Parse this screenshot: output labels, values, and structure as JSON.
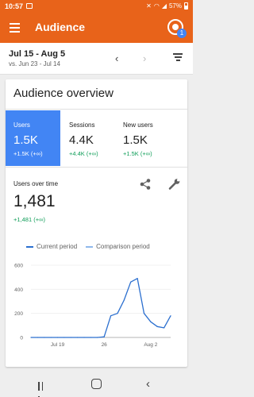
{
  "status_bar": {
    "time": "10:57",
    "battery": "57%"
  },
  "app_bar": {
    "title": "Audience",
    "badge": "1"
  },
  "date_range": {
    "current": "Jul 15 - Aug 5",
    "comparison": "vs. Jun 23 - Jul 14"
  },
  "card": {
    "title": "Audience overview",
    "metrics": [
      {
        "label": "Users",
        "value": "1.5K",
        "delta": "+1.5K (+∞)"
      },
      {
        "label": "Sessions",
        "value": "4.4K",
        "delta": "+4.4K (+∞)"
      },
      {
        "label": "New users",
        "value": "1.5K",
        "delta": "+1.5K (+∞)"
      }
    ],
    "users_over_time": {
      "label": "Users over time",
      "value": "1,481",
      "delta": "+1,481 (+∞)"
    }
  },
  "chart_data": {
    "type": "line",
    "series": [
      {
        "name": "Current period",
        "color": "#2b6fcf",
        "x": [
          "Jul 15",
          "Jul 16",
          "Jul 17",
          "Jul 18",
          "Jul 19",
          "Jul 20",
          "Jul 21",
          "Jul 22",
          "Jul 23",
          "Jul 24",
          "Jul 25",
          "Jul 26",
          "Jul 27",
          "Jul 28",
          "Jul 29",
          "Jul 30",
          "Jul 31",
          "Aug 1",
          "Aug 2",
          "Aug 3",
          "Aug 4",
          "Aug 5"
        ],
        "values": [
          0,
          0,
          0,
          0,
          0,
          0,
          0,
          0,
          0,
          0,
          0,
          5,
          180,
          200,
          310,
          460,
          490,
          200,
          130,
          90,
          80,
          180
        ]
      },
      {
        "name": "Comparison period",
        "color": "#8fb8ec",
        "values": []
      }
    ],
    "x_ticks": [
      "Jul 19",
      "26",
      "Aug 2"
    ],
    "y_ticks": [
      "0",
      "200",
      "400",
      "600"
    ],
    "ylim": [
      0,
      600
    ]
  }
}
